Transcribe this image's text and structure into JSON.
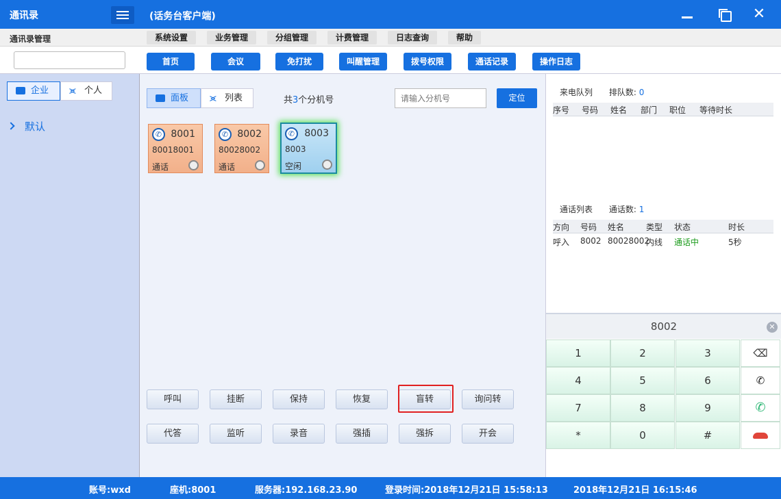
{
  "titlebar": {
    "app_title": "通讯录",
    "window_title": "(话务台客户端)",
    "min_label": "",
    "max_label": "",
    "close_label": "✕"
  },
  "menubar": {
    "left_label": "通讯录管理",
    "items": [
      "系统设置",
      "业务管理",
      "分组管理",
      "计费管理",
      "日志查询",
      "帮助"
    ]
  },
  "toolbar": {
    "buttons": [
      "首页",
      "会议",
      "免打扰",
      "叫醒管理",
      "拨号权限",
      "通话记录",
      "操作日志"
    ],
    "search_value": ""
  },
  "sidebar": {
    "tabs": [
      "企业",
      "个人"
    ],
    "tree_item": "默认"
  },
  "main": {
    "view_tabs": [
      "面板",
      "列表"
    ],
    "count_prefix": "共",
    "count_value": "3",
    "count_suffix": "个分机号",
    "search_placeholder": "请输入分机号",
    "locate_label": "定位",
    "extensions": [
      {
        "number": "8001",
        "name": "80018001",
        "status": "通话"
      },
      {
        "number": "8002",
        "name": "80028002",
        "status": "通话"
      },
      {
        "number": "8003",
        "name": "8003",
        "status": "空闲"
      }
    ],
    "actions_row1": [
      "呼叫",
      "挂断",
      "保持",
      "恢复",
      "盲转",
      "询问转"
    ],
    "actions_row2": [
      "代答",
      "监听",
      "录音",
      "强插",
      "强拆",
      "开会"
    ]
  },
  "right": {
    "queue_label": "来电队列",
    "queue_count_label": "排队数:",
    "queue_count": "0",
    "queue_headers": [
      "序号",
      "号码",
      "姓名",
      "部门",
      "职位",
      "等待时长"
    ],
    "calls_label": "通话列表",
    "calls_count_label": "通话数:",
    "calls_count": "1",
    "calls_headers": [
      "方向",
      "号码",
      "姓名",
      "类型",
      "状态",
      "时长"
    ],
    "calls_row": [
      "呼入",
      "8002",
      "80028002",
      "内线",
      "通话中",
      "5秒"
    ],
    "dial_display": "8002",
    "keys": [
      "1",
      "2",
      "3",
      "4",
      "5",
      "6",
      "7",
      "8",
      "9",
      "*",
      "0",
      "#"
    ]
  },
  "statusbar": {
    "account": "账号:wxd",
    "seat": "座机:8001",
    "server": "服务器:192.168.23.90",
    "login": "登录时间:2018年12月21日 15:58:13",
    "now": "2018年12月21日 16:15:46"
  },
  "colors": {
    "brand": "#1670e0",
    "busy_card": "#f2b08a",
    "idle_card": "#9fd0ef",
    "highlight": "#e02020",
    "active_status": "#1a9a1a"
  }
}
